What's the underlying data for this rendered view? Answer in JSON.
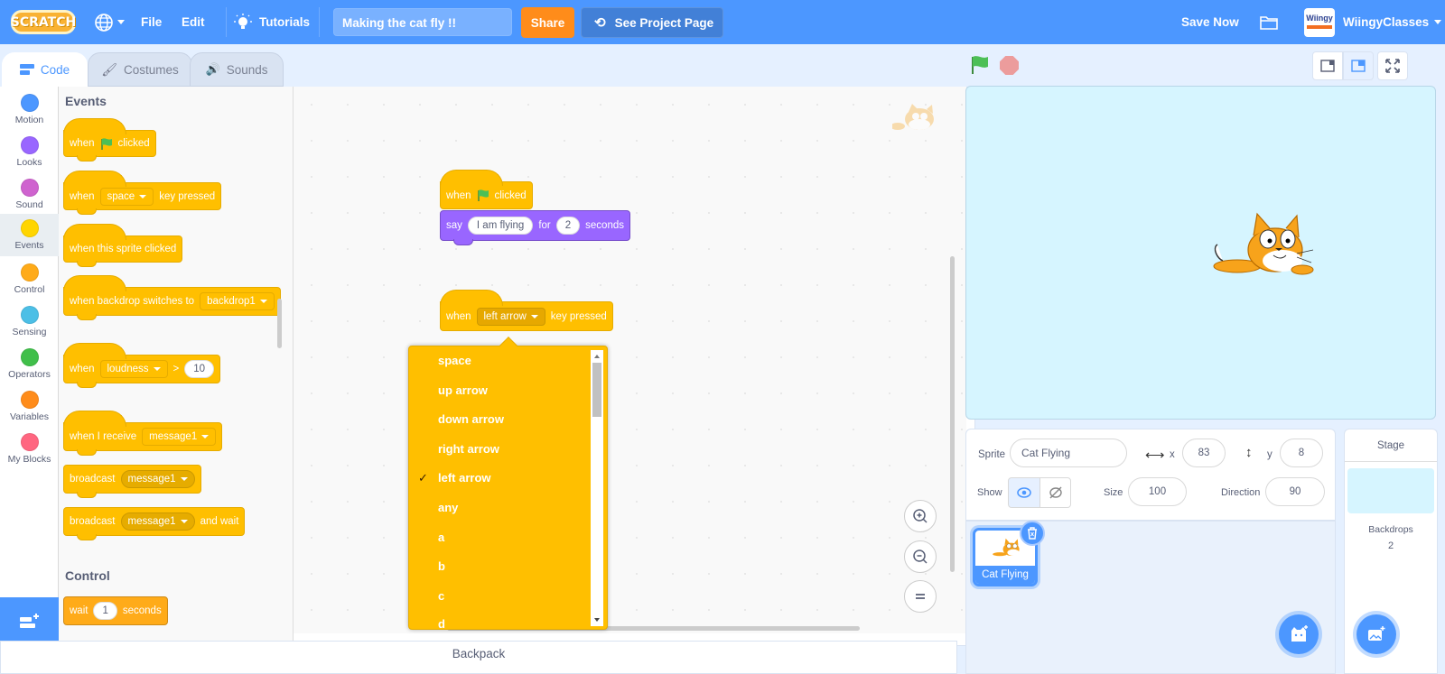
{
  "menubar": {
    "logo": "SCRATCH",
    "file": "File",
    "edit": "Edit",
    "tutorials": "Tutorials",
    "project_title": "Making the cat fly !!",
    "share": "Share",
    "see_project_page": "See Project Page",
    "save_now": "Save Now",
    "username": "WiingyClasses",
    "avatar_text": "Wiingy"
  },
  "tabs": [
    {
      "label": "Code",
      "active": true
    },
    {
      "label": "Costumes",
      "active": false
    },
    {
      "label": "Sounds",
      "active": false
    }
  ],
  "categories": [
    {
      "label": "Motion",
      "color": "#4c97ff"
    },
    {
      "label": "Looks",
      "color": "#9966ff"
    },
    {
      "label": "Sound",
      "color": "#cf63cf"
    },
    {
      "label": "Events",
      "color": "#ffd500"
    },
    {
      "label": "Control",
      "color": "#ffab19"
    },
    {
      "label": "Sensing",
      "color": "#4cbfe6"
    },
    {
      "label": "Operators",
      "color": "#40bf4a"
    },
    {
      "label": "Variables",
      "color": "#ff8c1a"
    },
    {
      "label": "My Blocks",
      "color": "#ff6680"
    }
  ],
  "palette": {
    "events_heading": "Events",
    "control_heading": "Control",
    "blocks": {
      "flag_when": "when",
      "flag_clicked": "clicked",
      "key_when": "when",
      "key_value": "space",
      "key_pressed": "key pressed",
      "sprite_clicked": "when this sprite clicked",
      "backdrop_text": "when backdrop switches to",
      "backdrop_value": "backdrop1",
      "loud_when": "when",
      "loud_value": "loudness",
      "loud_op": ">",
      "loud_num": "10",
      "receive_text": "when I receive",
      "receive_value": "message1",
      "broadcast_text": "broadcast",
      "broadcast_value": "message1",
      "bwait_text": "broadcast",
      "bwait_value": "message1",
      "bwait_suffix": "and wait",
      "wait_text": "wait",
      "wait_num": "1",
      "wait_suffix": "seconds"
    }
  },
  "workspace": {
    "script1": {
      "when": "when",
      "clicked": "clicked",
      "say": "say",
      "say_text": "I am flying",
      "for": "for",
      "secs": "2",
      "seconds": "seconds"
    },
    "script2": {
      "when": "when",
      "key": "left arrow",
      "pressed": "key pressed"
    },
    "dropdown": {
      "options": [
        "space",
        "up arrow",
        "down arrow",
        "right arrow",
        "left arrow",
        "any",
        "a",
        "b",
        "c",
        "d"
      ],
      "selected": "left arrow",
      "check": "✓"
    }
  },
  "backpack": "Backpack",
  "sprite_info": {
    "sprite_label": "Sprite",
    "sprite_name": "Cat Flying",
    "x_label": "x",
    "x": "83",
    "y_label": "y",
    "y": "8",
    "show_label": "Show",
    "size_label": "Size",
    "size": "100",
    "direction_label": "Direction",
    "direction": "90"
  },
  "sprites": [
    {
      "name": "Cat Flying",
      "selected": true
    }
  ],
  "stage_panel": {
    "title": "Stage",
    "backdrops_label": "Backdrops",
    "backdrops_count": "2"
  }
}
